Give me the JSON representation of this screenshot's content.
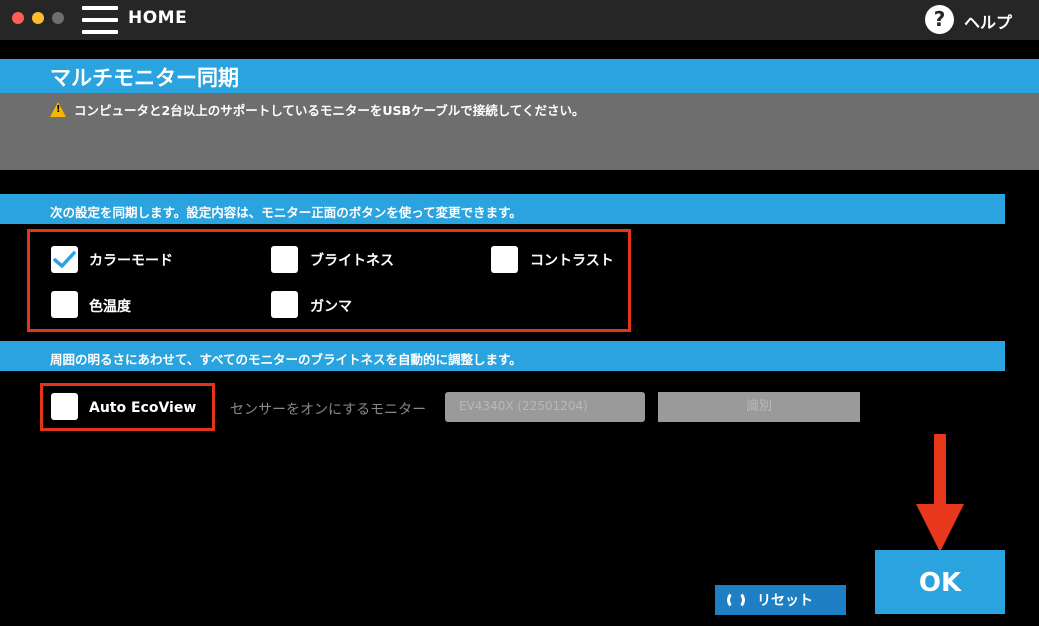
{
  "titlebar": {
    "home_label": "HOME",
    "help_icon_glyph": "?",
    "help_label": "ヘルプ"
  },
  "header": {
    "title": "マルチモニター同期",
    "warning": "コンピュータと2台以上のサポートしているモニターをUSBケーブルで接続してください。"
  },
  "sync_section": {
    "heading": "次の設定を同期します。設定内容は、モニター正面のボタンを使って変更できます。",
    "options": [
      {
        "label": "カラーモード",
        "checked": true
      },
      {
        "label": "ブライトネス",
        "checked": false
      },
      {
        "label": "コントラスト",
        "checked": false
      },
      {
        "label": "色温度",
        "checked": false
      },
      {
        "label": "ガンマ",
        "checked": false
      }
    ]
  },
  "auto_section": {
    "heading": "周囲の明るさにあわせて、すべてのモニターのブライトネスを自動的に調整します。",
    "auto_ecoview": {
      "label": "Auto EcoView",
      "checked": false
    },
    "sensor_label": "センサーをオンにするモニター",
    "monitor_select_value": "EV4340X (22501204)",
    "identify_label": "識別"
  },
  "footer": {
    "reset_label": "リセット",
    "ok_label": "OK"
  },
  "colors": {
    "accent": "#2aa3de",
    "highlight": "#e0341b",
    "warning": "#f5b800"
  }
}
